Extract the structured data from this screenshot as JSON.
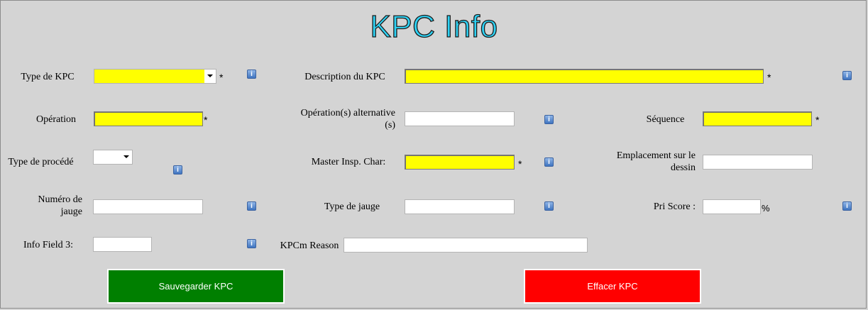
{
  "title": "KPC Info",
  "required_marker": "*",
  "info_glyph": "i",
  "colors": {
    "required_field": "#ffff00",
    "save_button": "#007f00",
    "clear_button": "#ff0000",
    "title": "#2ed3f5",
    "background": "#d4d4d4"
  },
  "fields": {
    "type_kpc": {
      "label": "Type de KPC",
      "value": ""
    },
    "operation": {
      "label": "Opération",
      "value": ""
    },
    "type_procede": {
      "label": "Type de procédé",
      "value": ""
    },
    "numero_jauge": {
      "label_line1": "Numéro de",
      "label_line2": "jauge",
      "value": ""
    },
    "info_field_3": {
      "label": "Info Field 3:",
      "value": ""
    },
    "description": {
      "label": "Description du KPC",
      "value": ""
    },
    "operation_alt": {
      "label_line1": "Opération(s) alternative",
      "label_line2": "(s)",
      "value": ""
    },
    "master_insp": {
      "label": "Master Insp. Char:",
      "value": ""
    },
    "type_jauge": {
      "label": "Type de jauge",
      "value": ""
    },
    "kpcm_reason": {
      "label": "KPCm Reason",
      "value": ""
    },
    "sequence": {
      "label": "Séquence",
      "value": ""
    },
    "emplacement": {
      "label_line1": "Emplacement sur le",
      "label_line2": "dessin",
      "value": ""
    },
    "pri_score": {
      "label": "Pri Score :",
      "value": "",
      "unit": "%"
    }
  },
  "buttons": {
    "save": "Sauvegarder KPC",
    "clear": "Effacer KPC"
  }
}
